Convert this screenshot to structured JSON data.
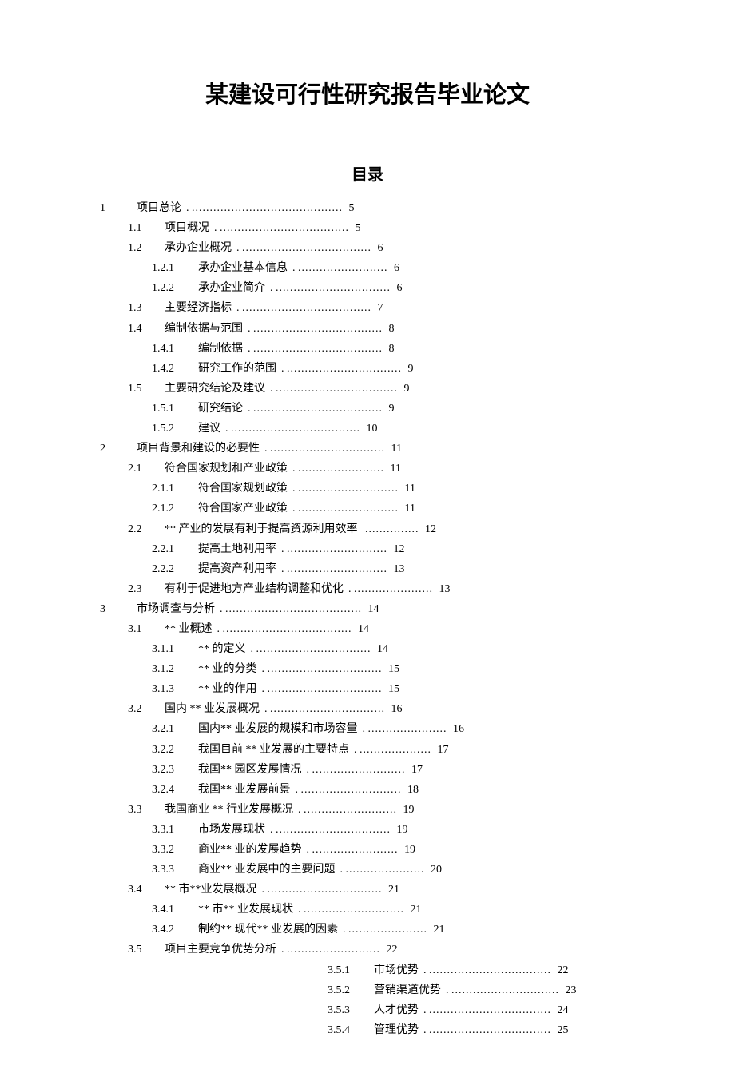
{
  "doc": {
    "title": "某建设可行性研究报告毕业论文",
    "toc_heading": "目录"
  },
  "toc": [
    {
      "num": "1",
      "text": "项目总论",
      "page": "5",
      "level": 0,
      "dots": 42
    },
    {
      "num": "1.1",
      "text": "项目概况",
      "page": "5",
      "level": 1,
      "dots": 36
    },
    {
      "num": "1.2",
      "text": "承办企业概况",
      "page": "6",
      "level": 1,
      "dots": 36
    },
    {
      "num": "1.2.1",
      "text": "承办企业基本信息",
      "page": "6",
      "level": 2,
      "dots": 25,
      "sep": "."
    },
    {
      "num": "1.2.2",
      "text": "承办企业简介",
      "page": "6",
      "level": 2,
      "dots": 32
    },
    {
      "num": "1.3",
      "text": "主要经济指标",
      "page": "7",
      "level": 1,
      "dots": 36
    },
    {
      "num": "1.4",
      "text": "编制依据与范围",
      "page": "8",
      "level": 1,
      "dots": 36
    },
    {
      "num": "1.4.1",
      "text": "编制依据",
      "page": "8",
      "level": 2,
      "dots": 36
    },
    {
      "num": "1.4.2",
      "text": "研究工作的范围",
      "page": "9",
      "level": 2,
      "dots": 32
    },
    {
      "num": "1.5",
      "text": "主要研究结论及建议",
      "page": "9",
      "level": 1,
      "dots": 34
    },
    {
      "num": "1.5.1",
      "text": "研究结论",
      "page": "9",
      "level": 2,
      "dots": 36
    },
    {
      "num": "1.5.2",
      "text": "建议",
      "page": "10",
      "level": 2,
      "dots": 36
    },
    {
      "num": "2",
      "text": "项目背景和建设的必要性",
      "page": "11",
      "level": 0,
      "dots": 32
    },
    {
      "num": "2.1",
      "text": "符合国家规划和产业政策",
      "page": "11",
      "level": 1,
      "dots": 24,
      "sep": "."
    },
    {
      "num": "2.1.1",
      "text": "符合国家规划政策",
      "page": "11",
      "level": 2,
      "dots": 28
    },
    {
      "num": "2.1.2",
      "text": "符合国家产业政策",
      "page": "11",
      "level": 2,
      "dots": 28
    },
    {
      "num": "2.2",
      "text": "** 产业的发展有利于提高资源利用效率",
      "page": "12",
      "level": 1,
      "dots": 15,
      "sep": " "
    },
    {
      "num": "2.2.1",
      "text": "提高土地利用率",
      "page": "12",
      "level": 2,
      "dots": 28
    },
    {
      "num": "2.2.2",
      "text": "提高资产利用率",
      "page": "13",
      "level": 2,
      "dots": 28
    },
    {
      "num": "2.3",
      "text": "有利于促进地方产业结构调整和优化",
      "page": "13",
      "level": 1,
      "dots": 22
    },
    {
      "num": "3",
      "text": "市场调查与分析",
      "page": "14",
      "level": 0,
      "dots": 38
    },
    {
      "num": "3.1",
      "text": "** 业概述",
      "page": "14",
      "level": 1,
      "dots": 36
    },
    {
      "num": "3.1.1",
      "text": "** 的定义",
      "page": "14",
      "level": 2,
      "dots": 32
    },
    {
      "num": "3.1.2",
      "text": "** 业的分类",
      "page": "15",
      "level": 2,
      "dots": 32
    },
    {
      "num": "3.1.3",
      "text": "** 业的作用",
      "page": "15",
      "level": 2,
      "dots": 32
    },
    {
      "num": "3.2",
      "text": "国内  ** 业发展概况",
      "page": "16",
      "level": 1,
      "dots": 32
    },
    {
      "num": "3.2.1",
      "text": "国内** 业发展的规模和市场容量",
      "page": "16",
      "level": 2,
      "dots": 22
    },
    {
      "num": "3.2.2",
      "text": "我国目前  ** 业发展的主要特点",
      "page": "17",
      "level": 2,
      "dots": 20
    },
    {
      "num": "3.2.3",
      "text": "我国** 园区发展情况",
      "page": "17",
      "level": 2,
      "dots": 26,
      "sep": "."
    },
    {
      "num": "3.2.4",
      "text": "我国** 业发展前景",
      "page": "18",
      "level": 2,
      "dots": 28
    },
    {
      "num": "3.3",
      "text": "我国商业  ** 行业发展概况",
      "page": "19",
      "level": 1,
      "dots": 26
    },
    {
      "num": "3.3.1",
      "text": "市场发展现状",
      "page": "19",
      "level": 2,
      "dots": 32
    },
    {
      "num": "3.3.2",
      "text": "商业** 业的发展趋势",
      "page": "19",
      "level": 2,
      "dots": 24,
      "sep": "."
    },
    {
      "num": "3.3.3",
      "text": "商业** 业发展中的主要问题",
      "page": "20",
      "level": 2,
      "dots": 22,
      "sep": "."
    },
    {
      "num": "3.4",
      "text": "** 市**业发展概况",
      "page": "21",
      "level": 1,
      "dots": 32
    },
    {
      "num": "3.4.1",
      "text": "** 市** 业发展现状",
      "page": "21",
      "level": 2,
      "dots": 28
    },
    {
      "num": "3.4.2",
      "text": "制约** 现代** 业发展的因素",
      "page": "21",
      "level": 2,
      "dots": 22,
      "sep": "."
    },
    {
      "num": "3.5",
      "text": "项目主要竞争优势分析",
      "page": "22",
      "level": 1,
      "dots": 26,
      "sep": "."
    },
    {
      "num": "3.5.1",
      "text": "市场优势",
      "page": "22",
      "level": 3,
      "dots": 34
    },
    {
      "num": "3.5.2",
      "text": "营销渠道优势",
      "page": "23",
      "level": 3,
      "dots": 30
    },
    {
      "num": "3.5.3",
      "text": "人才优势",
      "page": "24",
      "level": 3,
      "dots": 34
    },
    {
      "num": "3.5.4",
      "text": "管理优势",
      "page": "25",
      "level": 3,
      "dots": 34
    }
  ]
}
